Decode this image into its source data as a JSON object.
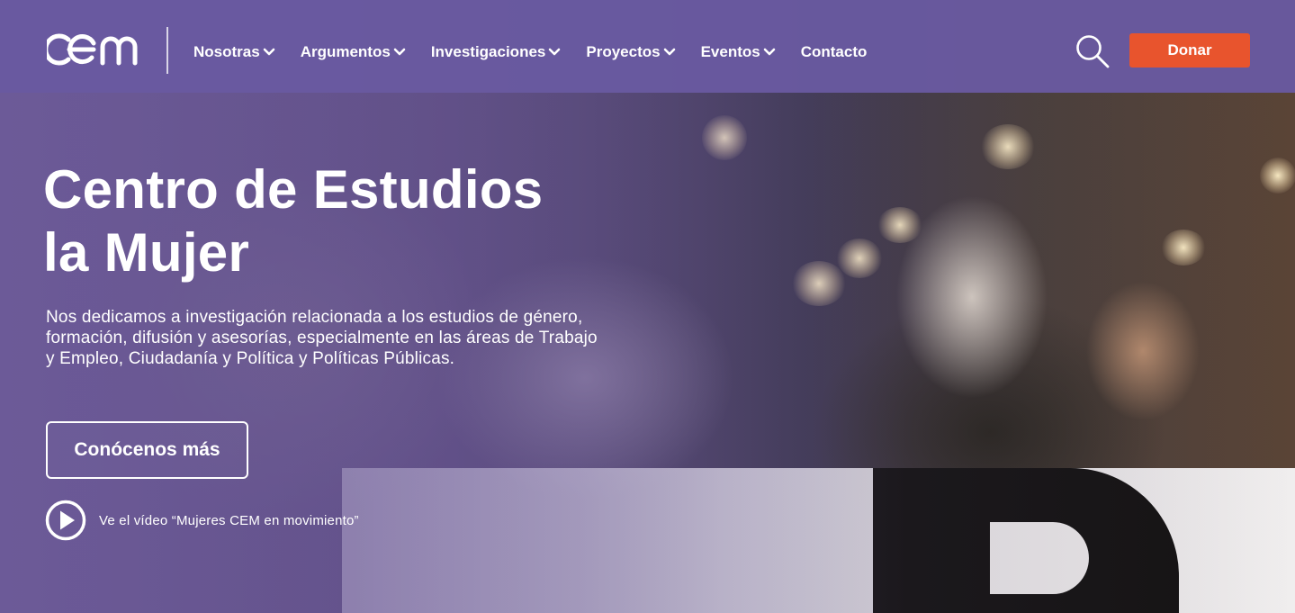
{
  "brand": {
    "logo_text": "cem",
    "colors": {
      "header": "#695aa0",
      "donate": "#e8542d",
      "text": "#ffffff"
    }
  },
  "header": {
    "nav": [
      {
        "label": "Nosotras",
        "has_dropdown": true
      },
      {
        "label": "Argumentos",
        "has_dropdown": true
      },
      {
        "label": "Investigaciones",
        "has_dropdown": true
      },
      {
        "label": "Proyectos",
        "has_dropdown": true
      },
      {
        "label": "Eventos",
        "has_dropdown": true
      },
      {
        "label": "Contacto",
        "has_dropdown": false
      }
    ],
    "search_icon": "search-icon",
    "donate_label": "Donar"
  },
  "hero": {
    "title_line1": "Centro de Estudios",
    "title_line2": "la Mujer",
    "description": "Nos dedicamos a investigación relacionada a los estudios de género, formación, difusión y asesorías, especialmente en las áreas de Trabajo y Empleo, Ciudadanía y Política y Políticas Públicas.",
    "cta_label": "Conócenos más",
    "video_icon": "play-circle-icon",
    "video_label": "Ve el vídeo “Mujeres CEM en movimiento”"
  }
}
